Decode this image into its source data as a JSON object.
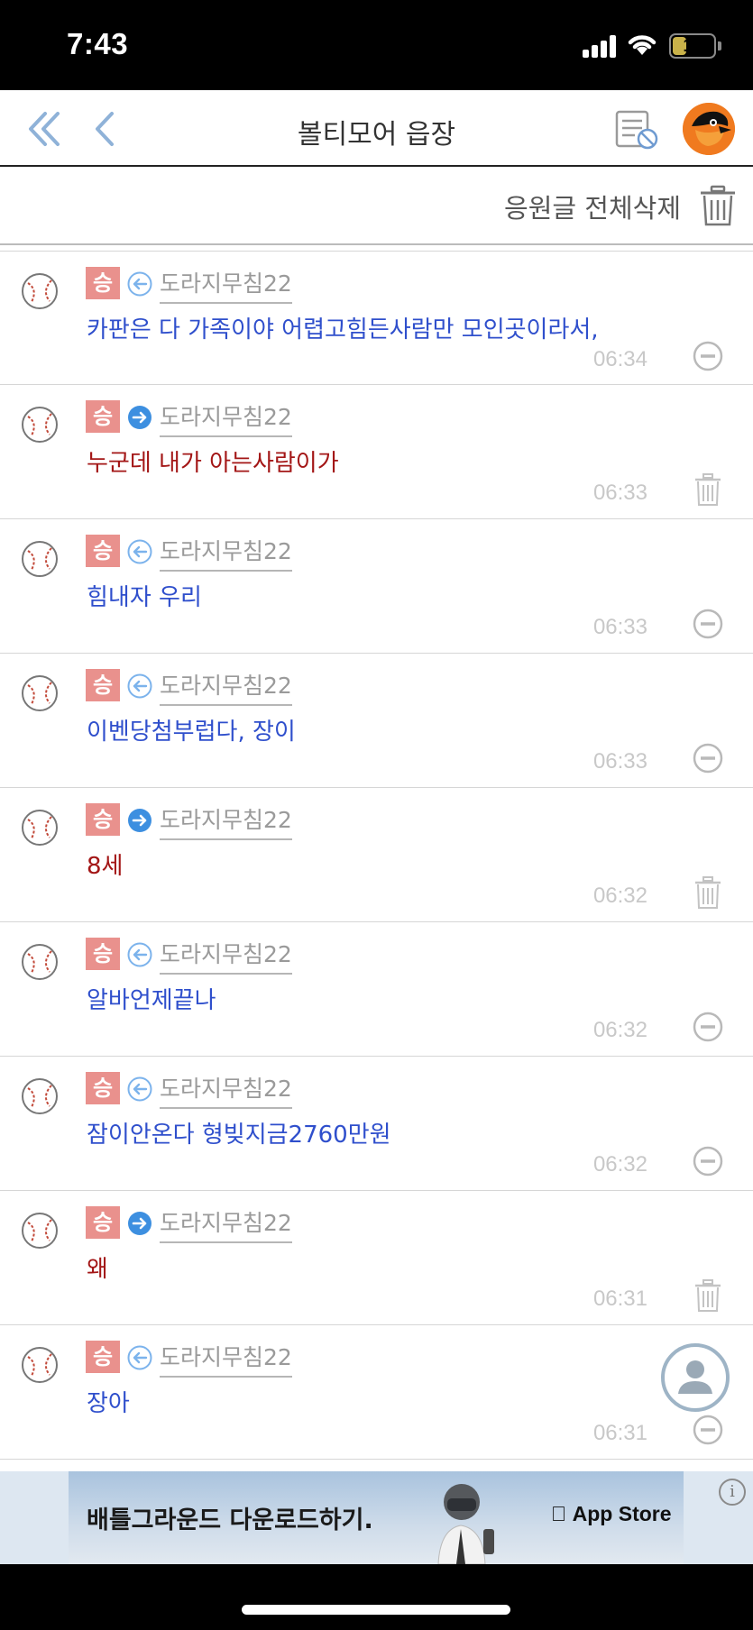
{
  "status_bar": {
    "time": "7:43",
    "battery": "11",
    "battery_level": 0.11
  },
  "nav": {
    "title": "볼티모어 읍장",
    "back_all_icon": "double-chevron-left-icon",
    "back_icon": "chevron-left-icon",
    "filter_icon": "list-block-icon",
    "team_logo": "orioles-logo"
  },
  "delete_all": {
    "label": "응원글 전체삭제",
    "icon": "trash-icon"
  },
  "messages": [
    {
      "badge": "승",
      "direction": "incoming",
      "user": "도라지무침22",
      "text": "카판은 다 가족이야 어렵고힘든사람만 모인곳이라서,",
      "time": "06:34",
      "action": "block"
    },
    {
      "badge": "승",
      "direction": "outgoing",
      "user": "도라지무침22",
      "text": "누군데 내가 아는사람이가",
      "time": "06:33",
      "action": "delete"
    },
    {
      "badge": "승",
      "direction": "incoming",
      "user": "도라지무침22",
      "text": "힘내자 우리",
      "time": "06:33",
      "action": "block"
    },
    {
      "badge": "승",
      "direction": "incoming",
      "user": "도라지무침22",
      "text": "이벤당첨부럽다, 장이",
      "time": "06:33",
      "action": "block"
    },
    {
      "badge": "승",
      "direction": "outgoing",
      "user": "도라지무침22",
      "text": "8세",
      "time": "06:32",
      "action": "delete"
    },
    {
      "badge": "승",
      "direction": "incoming",
      "user": "도라지무침22",
      "text": "알바언제끝나",
      "time": "06:32",
      "action": "block"
    },
    {
      "badge": "승",
      "direction": "incoming",
      "user": "도라지무침22",
      "text": "잠이안온다 형빚지금2760만원",
      "time": "06:32",
      "action": "block"
    },
    {
      "badge": "승",
      "direction": "outgoing",
      "user": "도라지무침22",
      "text": "왜",
      "time": "06:31",
      "action": "delete"
    },
    {
      "badge": "승",
      "direction": "incoming",
      "user": "도라지무침22",
      "text": "장아",
      "time": "06:31",
      "action": "block"
    }
  ],
  "ad": {
    "text": "배틀그라운드 다운로드하기.",
    "store": "App Store",
    "info": "i"
  },
  "colors": {
    "sent_text": "#2f4fcc",
    "received_text": "#a31616",
    "badge": "#e9918d",
    "arrow_in": "#7cb3ec",
    "arrow_out": "#3d8fe0"
  }
}
